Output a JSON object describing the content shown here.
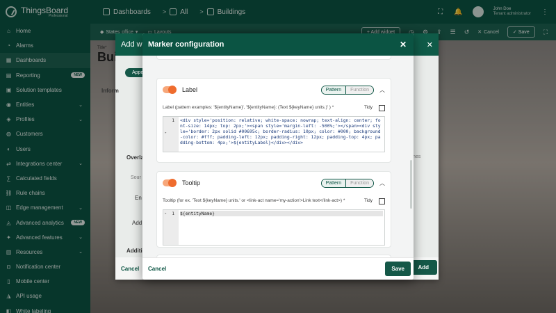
{
  "app": {
    "brand": "ThingsBoard",
    "brand_sub": "Professional"
  },
  "sidebar": {
    "items": [
      {
        "label": "Home",
        "icon": "home-icon",
        "chevron": false
      },
      {
        "label": "Alarms",
        "icon": "alarm-icon",
        "chevron": false
      },
      {
        "label": "Dashboards",
        "icon": "dashboards-icon",
        "chevron": false,
        "active": true
      },
      {
        "label": "Reporting",
        "icon": "reporting-icon",
        "badge": "NEW"
      },
      {
        "label": "Solution templates",
        "icon": "templates-icon",
        "chevron": false
      },
      {
        "label": "Entities",
        "icon": "entities-icon",
        "chevron": true
      },
      {
        "label": "Profiles",
        "icon": "profiles-icon",
        "chevron": true
      },
      {
        "label": "Customers",
        "icon": "customers-icon",
        "chevron": false
      },
      {
        "label": "Users",
        "icon": "users-icon",
        "chevron": false
      },
      {
        "label": "Integrations center",
        "icon": "integrations-icon",
        "chevron": true
      },
      {
        "label": "Calculated fields",
        "icon": "calc-icon",
        "chevron": false
      },
      {
        "label": "Rule chains",
        "icon": "rule-chains-icon",
        "chevron": false
      },
      {
        "label": "Edge management",
        "icon": "edge-icon",
        "chevron": true
      },
      {
        "label": "Advanced analytics",
        "icon": "analytics-icon",
        "badge": "NEW"
      },
      {
        "label": "Advanced features",
        "icon": "features-icon",
        "chevron": true
      },
      {
        "label": "Resources",
        "icon": "resources-icon",
        "chevron": true
      },
      {
        "label": "Notification center",
        "icon": "notification-icon",
        "chevron": false
      },
      {
        "label": "Mobile center",
        "icon": "mobile-icon",
        "chevron": false
      },
      {
        "label": "API usage",
        "icon": "api-icon",
        "chevron": false
      },
      {
        "label": "White labeling",
        "icon": "white-label-icon",
        "chevron": false
      }
    ]
  },
  "topbar": {
    "crumbs": [
      "Dashboards",
      "All",
      "Buildings"
    ],
    "user_name": "John Doe",
    "user_role": "Tenant administrator"
  },
  "toolbar": {
    "states_label": "States",
    "states_value": "office",
    "layouts_label": "Layouts",
    "add_widget": "+ Add widget",
    "cancel": "Cancel",
    "save": "Save"
  },
  "dashboard": {
    "title_label": "Title*",
    "title": "Bui"
  },
  "add_widget_dialog": {
    "title": "Add w",
    "tab_appearance": "Appe",
    "section_info": "Inform",
    "section_overlay": "Overla",
    "section_additional": "Additi",
    "source_label": "Sour",
    "en_label": "En",
    "add_label": "Add",
    "source_label2": "Sour",
    "nes_label": "nes",
    "cancel": "Cancel",
    "add": "Add"
  },
  "marker_dialog": {
    "title": "Marker configuration",
    "cancel": "Cancel",
    "save": "Save",
    "label_section": {
      "title": "Label",
      "mode_pattern": "Pattern",
      "mode_function": "Function",
      "hint": "Label (pattern examples: '${entityName}', '${entityName}: (Text ${keyName} units.)' ) *",
      "tidy": "Tidy",
      "line_no": "1",
      "code": "<div style='position: relative; white-space: nowrap; text-align: center; font-size: 14px; top: 2px;'><span style='margin-left: -500%;'></span><div style='border: 2px solid #00695c; border-radius: 10px; color: #000; background-color: #fff; padding-left: 12px; padding-right: 12px; padding-top: 4px; padding-bottom: 4px;'>${entityLabel}</div></div>"
    },
    "tooltip_section": {
      "title": "Tooltip",
      "mode_pattern": "Pattern",
      "mode_function": "Function",
      "hint": "Tooltip (for ex. 'Text ${keyName} units.' or <link-act name='my-action'>Link text</link-act>) *",
      "tidy": "Tidy",
      "line_no": "1",
      "code": "${entityName}"
    }
  }
}
